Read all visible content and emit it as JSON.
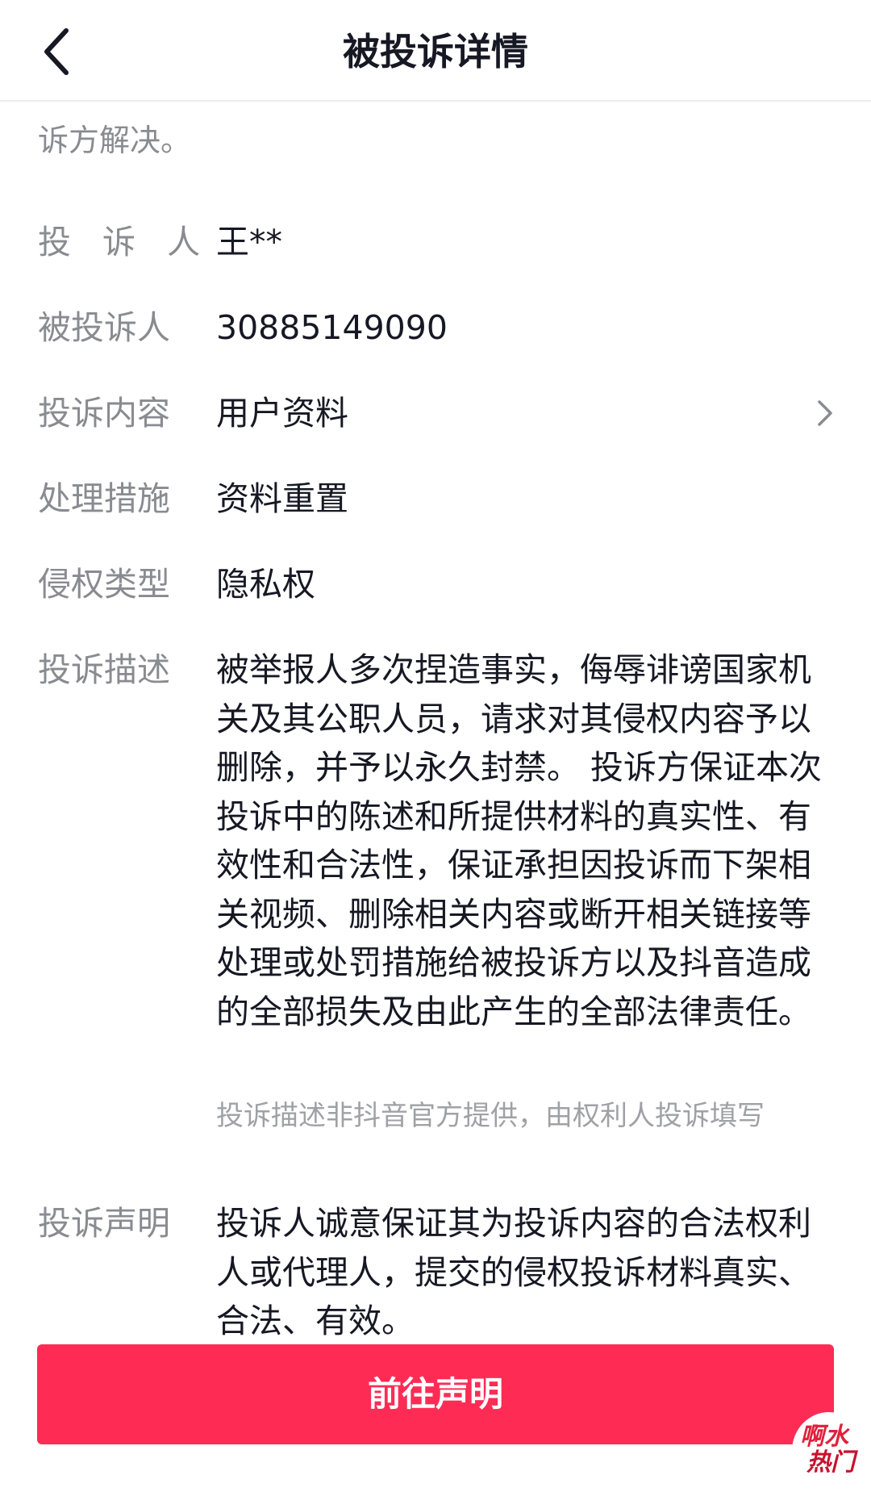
{
  "header": {
    "title": "被投诉详情"
  },
  "content": {
    "truncated_tail": "诉方解决。",
    "fields": [
      {
        "label": "投 诉 人",
        "value": "王**"
      },
      {
        "label": "被投诉人",
        "value": "30885149090"
      },
      {
        "label": "投诉内容",
        "value": "用户资料",
        "icon": "chevron-right-icon"
      },
      {
        "label": "处理措施",
        "value": "资料重置"
      },
      {
        "label": "侵权类型",
        "value": "隐私权"
      },
      {
        "label": "投诉描述",
        "value": "被举报人多次捏造事实，侮辱诽谤国家机关及其公职人员，请求对其侵权内容予以删除，并予以永久封禁。 投诉方保证本次投诉中的陈述和所提供材料的真实性、有效性和合法性，保证承担因投诉而下架相关视频、删除相关内容或断开相关链接等处理或处罚措施给被投诉方以及抖音造成的全部损失及由此产生的全部法律责任。"
      },
      {
        "label": "投诉声明",
        "value": "投诉人诚意保证其为投诉内容的合法权利人或代理人，提交的侵权投诉材料真实、合法、有效。"
      }
    ],
    "description_note": "投诉描述非抖音官方提供，由权利人投诉填写"
  },
  "footer": {
    "cta_label": "前往声明"
  },
  "watermark": {
    "line1": "啊水",
    "line2": "热门"
  },
  "colors": {
    "accent": "#fe2c55",
    "label": "#8a8b91",
    "text": "#161823"
  }
}
